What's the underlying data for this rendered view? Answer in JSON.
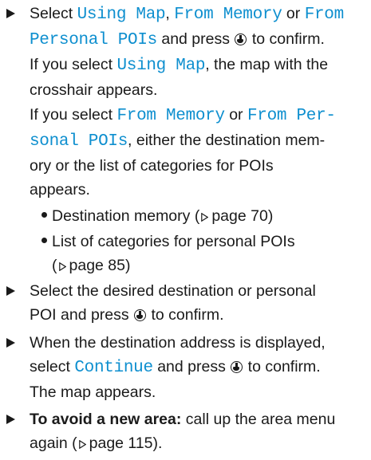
{
  "step1": {
    "prefix": "Select ",
    "opt_map": "Using Map",
    "sep1": ", ",
    "opt_memory": "From Memory",
    "or_text": " or ",
    "opt_personal_a": "From",
    "opt_personal_b": "Personal POIs",
    "suffix_a": " and press ",
    "suffix_b": " to confirm.",
    "line3": "If you select ",
    "line3_opt": "Using Map",
    "line3_b": ", the map with the",
    "line4": "crosshair appears."
  },
  "para2": {
    "a": "If you select ",
    "opt_memory": "From Memory",
    "or_text": " or ",
    "opt_personal_a": "From Per-",
    "opt_personal_b": "sonal POIs",
    "b": ", either the destination mem-",
    "c": "ory or the list of categories for POIs",
    "d": "appears."
  },
  "bullets": [
    {
      "text": "Destination memory (",
      "page": "page 70",
      "close": ")"
    },
    {
      "text": "List of categories for personal POIs",
      "page": "page 85",
      "close": ")",
      "open": "("
    }
  ],
  "step2": {
    "a": "Select the desired destination or personal",
    "b": "POI and press ",
    "c": " to confirm."
  },
  "step3": {
    "a": "When the destination address is displayed,",
    "b": "select ",
    "opt": "Continue",
    "c": " and press ",
    "d": " to confirm.",
    "e": "The map appears."
  },
  "step4": {
    "bold": "To avoid a new area:",
    "a": " call up the area menu",
    "b": "again (",
    "page": "page 115",
    "close": ")."
  },
  "icons": {
    "step_arrow": "step-arrow-icon",
    "knob": "controller-knob-icon",
    "page_ref": "page-reference-triangle-icon"
  },
  "colors": {
    "ui_text": "#0e8fcf",
    "body_text": "#1a1a1a"
  }
}
